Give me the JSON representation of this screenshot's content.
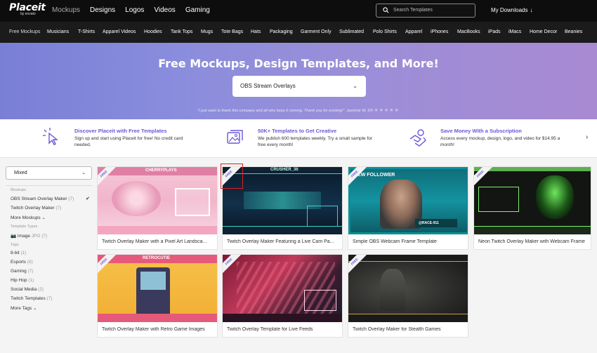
{
  "brand": {
    "logo": "Placeit",
    "sub": "by envato"
  },
  "topnav": [
    "Mockups",
    "Designs",
    "Logos",
    "Videos",
    "Gaming"
  ],
  "search": {
    "placeholder": "Search Templates"
  },
  "account": {
    "downloads": "My Downloads"
  },
  "categories": [
    "Free Mockups",
    "Musicians",
    "T-Shirts",
    "Apparel Videos",
    "Hoodies",
    "Tank Tops",
    "Mugs",
    "Tote Bags",
    "Hats",
    "Packaging",
    "Garment Only",
    "Sublimated",
    "Polo Shirts",
    "Apparel",
    "iPhones",
    "MacBooks",
    "iPads",
    "iMacs",
    "Home Decor",
    "Beanies"
  ],
  "hero": {
    "title": "Free Mockups, Design Templates, and More!",
    "select_value": "OBS Stream Overlays",
    "quote": "\"I just want to thank this company and all who keep it running. Thank you for existing!\"",
    "author": "Jasmine W. 5/5",
    "stars": "★★★★★"
  },
  "features": [
    {
      "title": "Discover Placeit with Free Templates",
      "desc": "Sign up and start using Placeit for free! No credit card needed."
    },
    {
      "title": "50K+ Templates to Get Creative",
      "desc": "We publish 600 templates weekly. Try a small sample for free every month!"
    },
    {
      "title": "Save Money With a Subscription",
      "desc": "Access every mockup, design, logo, and video for $14.95 a month!"
    }
  ],
  "sidebar": {
    "sort": "Mixed",
    "sections": {
      "mockups_label": "Mockups",
      "template_types_label": "Template Types",
      "tags_label": "Tags"
    },
    "mockups": [
      {
        "label": "OBS Stream Overlay Maker",
        "count": "(7)"
      },
      {
        "label": "Twitch Overlay Maker",
        "count": "(7)"
      }
    ],
    "more_mockups": "More Mockups",
    "template_types": [
      {
        "label": "Image",
        "count": "JPG",
        "extra": "(7)"
      }
    ],
    "tags": [
      {
        "label": "8-bit",
        "count": "(1)"
      },
      {
        "label": "Esports",
        "count": "(6)"
      },
      {
        "label": "Gaming",
        "count": "(7)"
      },
      {
        "label": "Hip Hop",
        "count": "(1)"
      },
      {
        "label": "Social Media",
        "count": "(2)"
      },
      {
        "label": "Twitch Templates",
        "count": "(7)"
      }
    ],
    "more_tags": "More Tags"
  },
  "free_badge": "FREE",
  "cards": [
    {
      "caption": "Twitch Overlay Maker with a Pixel Art Landsca...",
      "thumb_text": "CHERRYPLAYS"
    },
    {
      "caption": "Twitch Overlay Maker Featuring a Live Cam Pa...",
      "thumb_text": "CRUSHER_36"
    },
    {
      "caption": "Simple OBS Webcam Frame Template",
      "thumb_text": "NEW FOLLOWER",
      "thumb_text2": "@RACE-911"
    },
    {
      "caption": "Neon Twitch Overlay Maker with Webcam Frame",
      "thumb_text": ""
    },
    {
      "caption": "Twitch Overlay Maker with Retro Game Images",
      "thumb_text": "RETROCUTIE"
    },
    {
      "caption": "Twitch Overlay Template for Live Feeds",
      "thumb_text": ""
    },
    {
      "caption": "Twitch Overlay Maker for Stealth Games",
      "thumb_text": ""
    }
  ]
}
